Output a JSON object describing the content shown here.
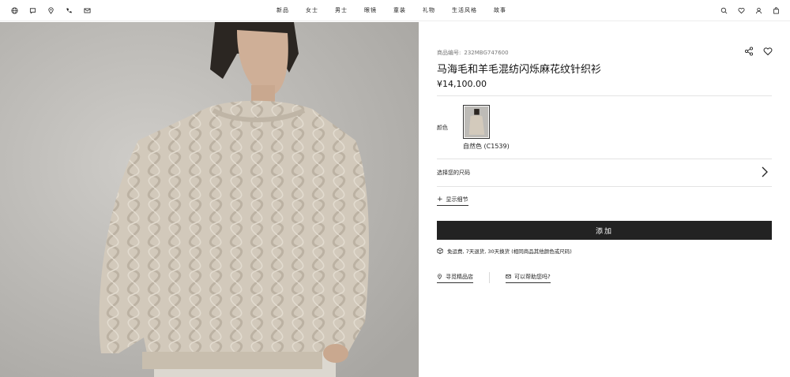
{
  "header": {
    "left_icons": [
      "globe-icon",
      "chat-icon",
      "location-icon",
      "phone-icon",
      "mail-icon"
    ],
    "nav": [
      "新品",
      "女士",
      "男士",
      "眼镜",
      "童装",
      "礼物",
      "生活风格",
      "故事"
    ],
    "right_icons": [
      "search-icon",
      "heart-icon",
      "user-icon",
      "bag-icon"
    ]
  },
  "product": {
    "sku_label": "商品编号:",
    "sku": "232MBG747600",
    "title": "马海毛和羊毛混纺闪烁麻花纹针织衫",
    "price": "¥14,100.00",
    "color_label": "颜色",
    "color_name": "自然色 (C1539)",
    "size_label": "选择您的尺码",
    "details_label": "显示细节",
    "add_button": "添加",
    "shipping_note": "免运费, 7天退货, 30天换货 (相同商品其他颜色或尺码)",
    "store_link": "寻觅精品店",
    "help_link": "可以帮助您吗?"
  },
  "colors": {
    "accent": "#222222",
    "rule": "#e3e3e3",
    "sweater": "#cfc6b8",
    "background": "#b9b7b3"
  }
}
